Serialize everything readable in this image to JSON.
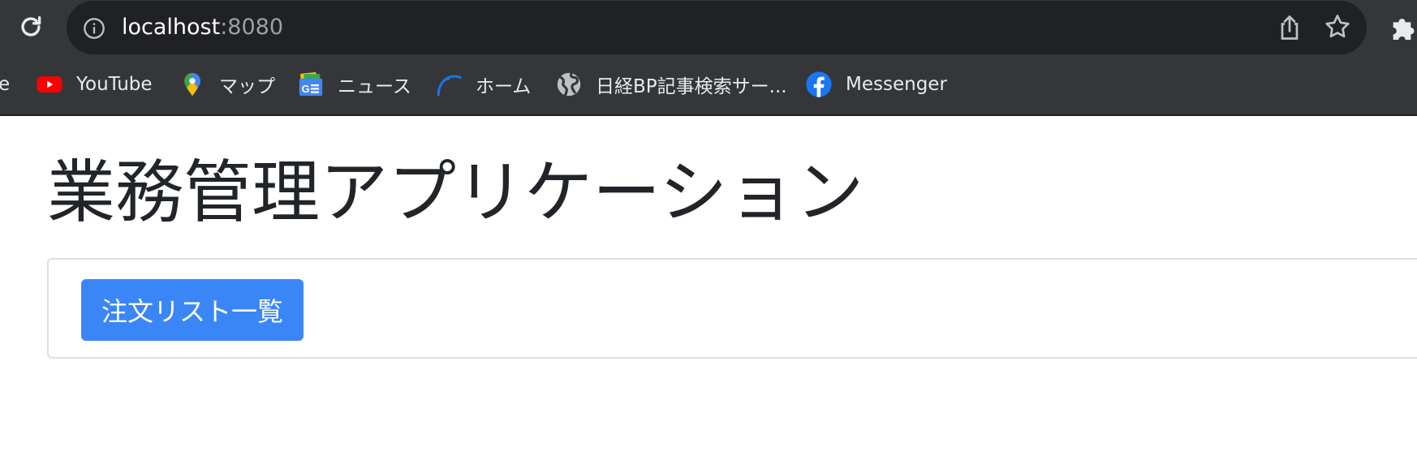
{
  "browser": {
    "url_host": "localhost",
    "url_port": ":8080",
    "icons": {
      "reload": "reload-icon",
      "info": "info-icon",
      "share": "share-icon",
      "bookmark": "star-icon",
      "extensions": "puzzle-icon"
    }
  },
  "bookmarks": [
    {
      "label": "e"
    },
    {
      "label": "YouTube",
      "icon": "youtube-icon"
    },
    {
      "label": "マップ",
      "icon": "google-maps-icon"
    },
    {
      "label": "ニュース",
      "icon": "google-news-icon"
    },
    {
      "label": "ホーム",
      "icon": "home-arc-icon"
    },
    {
      "label": "日経BP記事検索サー...",
      "icon": "globe-icon"
    },
    {
      "label": "Messenger",
      "icon": "facebook-icon"
    }
  ],
  "page": {
    "title": "業務管理アプリケーション",
    "order_list_button": "注文リスト一覧"
  },
  "colors": {
    "toolbar": "#35363a",
    "omnibox": "#202124",
    "primary_button": "#3b86f6",
    "title_text": "#212529"
  }
}
